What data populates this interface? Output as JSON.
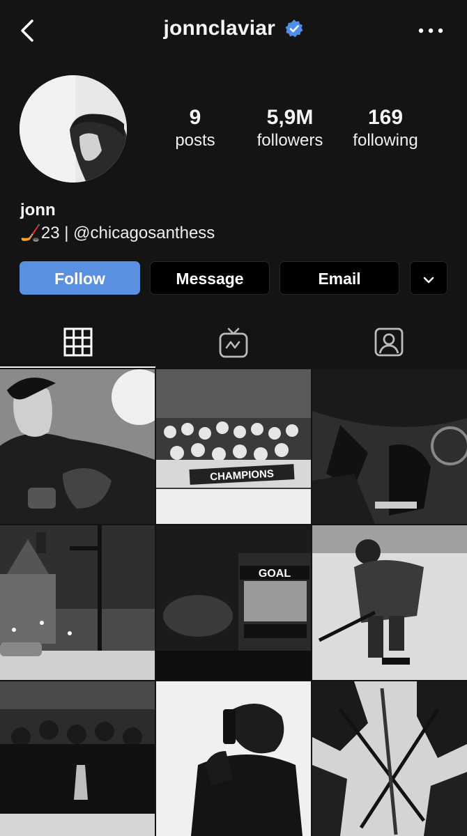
{
  "header": {
    "username": "jonnclaviar",
    "back_icon": "chevron-left-icon",
    "verified_icon": "verified-badge-icon",
    "more_icon": "more-horizontal-icon",
    "verified_color": "#4f8fe8"
  },
  "profile": {
    "name": "jonn",
    "bio": "🏒23 | @chicagosanthess"
  },
  "stats": [
    {
      "value": "9",
      "label": "posts"
    },
    {
      "value": "5,9M",
      "label": "followers"
    },
    {
      "value": "169",
      "label": "following"
    }
  ],
  "buttons": {
    "follow": "Follow",
    "message": "Message",
    "email": "Email",
    "dropdown_icon": "chevron-down-icon"
  },
  "tabs": [
    {
      "icon": "grid-icon",
      "active": true
    },
    {
      "icon": "igtv-icon",
      "active": false
    },
    {
      "icon": "tagged-icon",
      "active": false
    }
  ],
  "colors": {
    "background": "#141414",
    "follow_button": "#5b8fe0",
    "button": "#000000"
  },
  "posts": [
    {
      "subject": "player portrait in jersey"
    },
    {
      "subject": "team celebration CHAMPIONS",
      "text": "CHAMPIONS"
    },
    {
      "subject": "hockey gear on ice"
    },
    {
      "subject": "snowy city street"
    },
    {
      "subject": "arena jumbotron GOAL",
      "text": "GOAL"
    },
    {
      "subject": "player skating with stick"
    },
    {
      "subject": "team with trophy"
    },
    {
      "subject": "mirror selfie in suit"
    },
    {
      "subject": "sticks crossed on ice"
    }
  ]
}
